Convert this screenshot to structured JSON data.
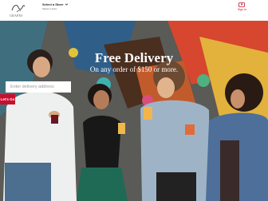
{
  "header": {
    "logo_text": "GRAPES",
    "store_title": "Select a Store",
    "store_subtitle": "Select a store",
    "signin_label": "Sign In"
  },
  "hero": {
    "headline": "Free Delivery",
    "subhead": "On any order of $150 or more.",
    "address_placeholder": "Enter delivery address",
    "go_label": "Let's Go"
  },
  "colors": {
    "brand_red": "#c8102e"
  }
}
